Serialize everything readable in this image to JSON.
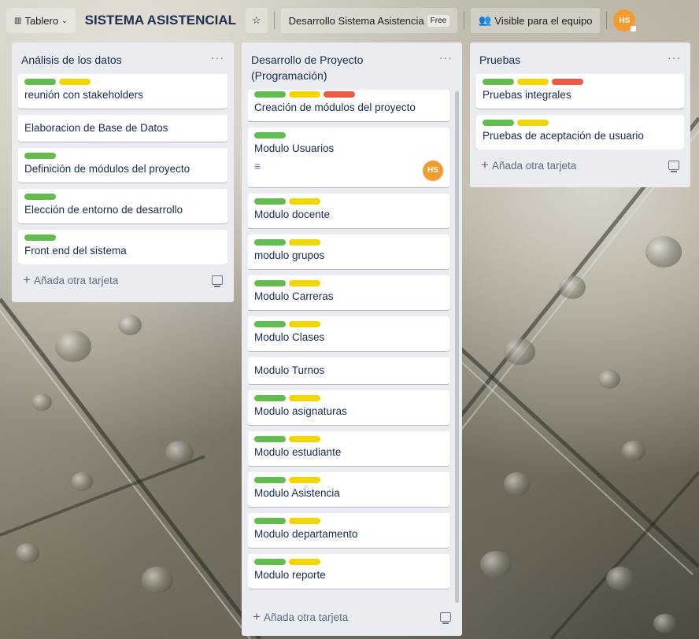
{
  "colors": {
    "green": "#61bd4f",
    "yellow": "#f2d600",
    "red": "#eb5a46",
    "avatar": "#f39c2d"
  },
  "header": {
    "board_switch": "Tablero",
    "board_title": "SISTEMA ASISTENCIAL",
    "star_icon": "star-icon",
    "team_name": "Desarrollo Sistema Asistencia",
    "team_badge": "Free",
    "visibility": "Visible para el equipo",
    "avatar_initials": "HS"
  },
  "lists": [
    {
      "title": "Análisis de los datos",
      "menu": "···",
      "add_card": "Añada otra tarjeta",
      "cards": [
        {
          "title": "reunión con stakeholders",
          "labels": [
            "green",
            "yellow"
          ]
        },
        {
          "title": "Elaboracion de Base de Datos",
          "labels": []
        },
        {
          "title": "Definición de módulos del proyecto",
          "labels": [
            "green"
          ]
        },
        {
          "title": "Elección de entorno de desarrollo",
          "labels": [
            "green"
          ]
        },
        {
          "title": "Front end del sistema",
          "labels": [
            "green"
          ]
        }
      ]
    },
    {
      "title": "Desarrollo de Proyecto (Programación)",
      "menu": "···",
      "add_card": "Añada otra tarjeta",
      "cards": [
        {
          "title": "Creación de módulos del proyecto",
          "labels": [
            "green",
            "yellow",
            "red"
          ]
        },
        {
          "title": "Modulo Usuarios",
          "labels": [
            "green"
          ],
          "has_description": true,
          "member": "HS"
        },
        {
          "title": "Modulo docente",
          "labels": [
            "green",
            "yellow"
          ]
        },
        {
          "title": "modulo grupos",
          "labels": [
            "green",
            "yellow"
          ]
        },
        {
          "title": "Modulo Carreras",
          "labels": [
            "green",
            "yellow"
          ]
        },
        {
          "title": "Modulo Clases",
          "labels": [
            "green",
            "yellow"
          ]
        },
        {
          "title": "Modulo Turnos",
          "labels": []
        },
        {
          "title": "Modulo asignaturas",
          "labels": [
            "green",
            "yellow"
          ]
        },
        {
          "title": "Modulo estudiante",
          "labels": [
            "green",
            "yellow"
          ]
        },
        {
          "title": "Modulo Asistencia",
          "labels": [
            "green",
            "yellow"
          ]
        },
        {
          "title": "Modulo departamento",
          "labels": [
            "green",
            "yellow"
          ]
        },
        {
          "title": "Modulo reporte",
          "labels": [
            "green",
            "yellow"
          ]
        }
      ]
    },
    {
      "title": "Pruebas",
      "menu": "···",
      "add_card": "Añada otra tarjeta",
      "cards": [
        {
          "title": "Pruebas integrales",
          "labels": [
            "green",
            "yellow",
            "red"
          ]
        },
        {
          "title": "Pruebas de aceptación de usuario",
          "labels": [
            "green",
            "yellow"
          ]
        }
      ]
    }
  ]
}
